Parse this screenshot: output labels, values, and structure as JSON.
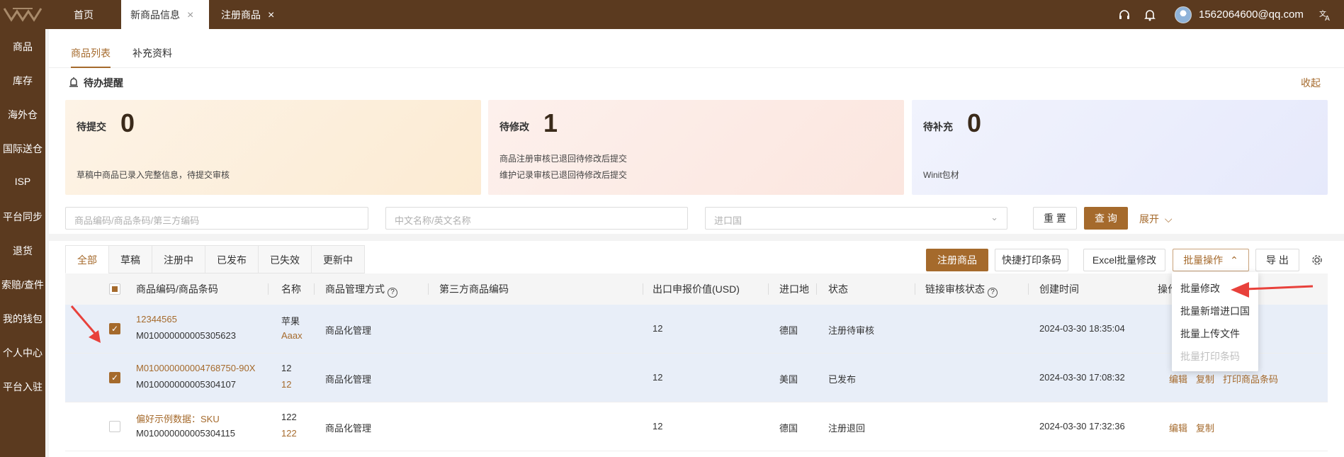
{
  "topbar": {
    "tabs": [
      {
        "label": "首页"
      },
      {
        "label": "新商品信息",
        "close": "×"
      },
      {
        "label": "注册商品",
        "close": "×"
      }
    ],
    "user_email": "1562064600@qq.com",
    "icons": [
      "headset-icon",
      "bell-icon",
      "avatar",
      "translate-icon"
    ]
  },
  "sidebar": {
    "items": [
      "商品",
      "库存",
      "海外仓",
      "国际送仓",
      "ISP",
      "平台同步",
      "退货",
      "索赔/查件",
      "我的钱包",
      "个人中心",
      "平台入驻"
    ]
  },
  "subtabs": [
    "商品列表",
    "补充资料"
  ],
  "todo": {
    "title": "待办提醒",
    "collapse": "收起",
    "cards": [
      {
        "label": "待提交",
        "count": "0",
        "lines": [
          "草稿中商品已录入完整信息，待提交审核"
        ],
        "color": "#fdf0de"
      },
      {
        "label": "待修改",
        "count": "1",
        "lines": [
          "商品注册审核已退回待修改后提交",
          "维护记录审核已退回待修改后提交"
        ],
        "color": "#fdeee9"
      },
      {
        "label": "待补充",
        "count": "0",
        "lines": [
          "Winit包材"
        ],
        "color": "#eef0fc"
      }
    ]
  },
  "search": {
    "code_placeholder": "商品编码/商品条码/第三方编码",
    "name_placeholder": "中文名称/英文名称",
    "country_placeholder": "进口国",
    "reset": "重 置",
    "query": "查 询",
    "expand": "展开"
  },
  "filter_tabs": [
    "全部",
    "草稿",
    "注册中",
    "已发布",
    "已失效",
    "更新中"
  ],
  "actions": {
    "register": "注册商品",
    "quick_print": "快捷打印条码",
    "excel_edit": "Excel批量修改",
    "batch": "批量操作",
    "export": "导 出"
  },
  "table": {
    "headers": [
      "商品编码/商品条码",
      "名称",
      "商品管理方式",
      "第三方商品编码",
      "出口申报价值(USD)",
      "进口地",
      "状态",
      "链接审核状态",
      "创建时间",
      "操作"
    ],
    "rows": [
      {
        "checked": true,
        "code": "12344565",
        "barcode": "M010000000005305623",
        "name": "苹果",
        "name2": "Aaax",
        "mode": "商品化管理",
        "value": "12",
        "country": "德国",
        "status": "注册待审核",
        "created": "2024-03-30 18:35:04",
        "ops": []
      },
      {
        "checked": true,
        "code": "M010000000004768750-90X",
        "barcode": "M010000000005304107",
        "name": "12",
        "name2": "12",
        "mode": "商品化管理",
        "value": "12",
        "country": "美国",
        "status": "已发布",
        "created": "2024-03-30 17:08:32",
        "ops": [
          "编辑",
          "复制",
          "打印商品条码"
        ]
      },
      {
        "checked": false,
        "code": "偏好示例数据：SKU",
        "barcode": "M010000000005304115",
        "name": "122",
        "name2": "122",
        "mode": "商品化管理",
        "value": "12",
        "country": "德国",
        "status": "注册退回",
        "created": "2024-03-30 17:32:36",
        "ops": [
          "编辑",
          "复制"
        ]
      }
    ]
  },
  "dropdown": {
    "items": [
      {
        "label": "批量修改",
        "disabled": false
      },
      {
        "label": "批量新增进口国",
        "disabled": false
      },
      {
        "label": "批量上传文件",
        "disabled": false
      },
      {
        "label": "批量打印条码",
        "disabled": true
      }
    ]
  },
  "annotation_color": "#e8413b"
}
